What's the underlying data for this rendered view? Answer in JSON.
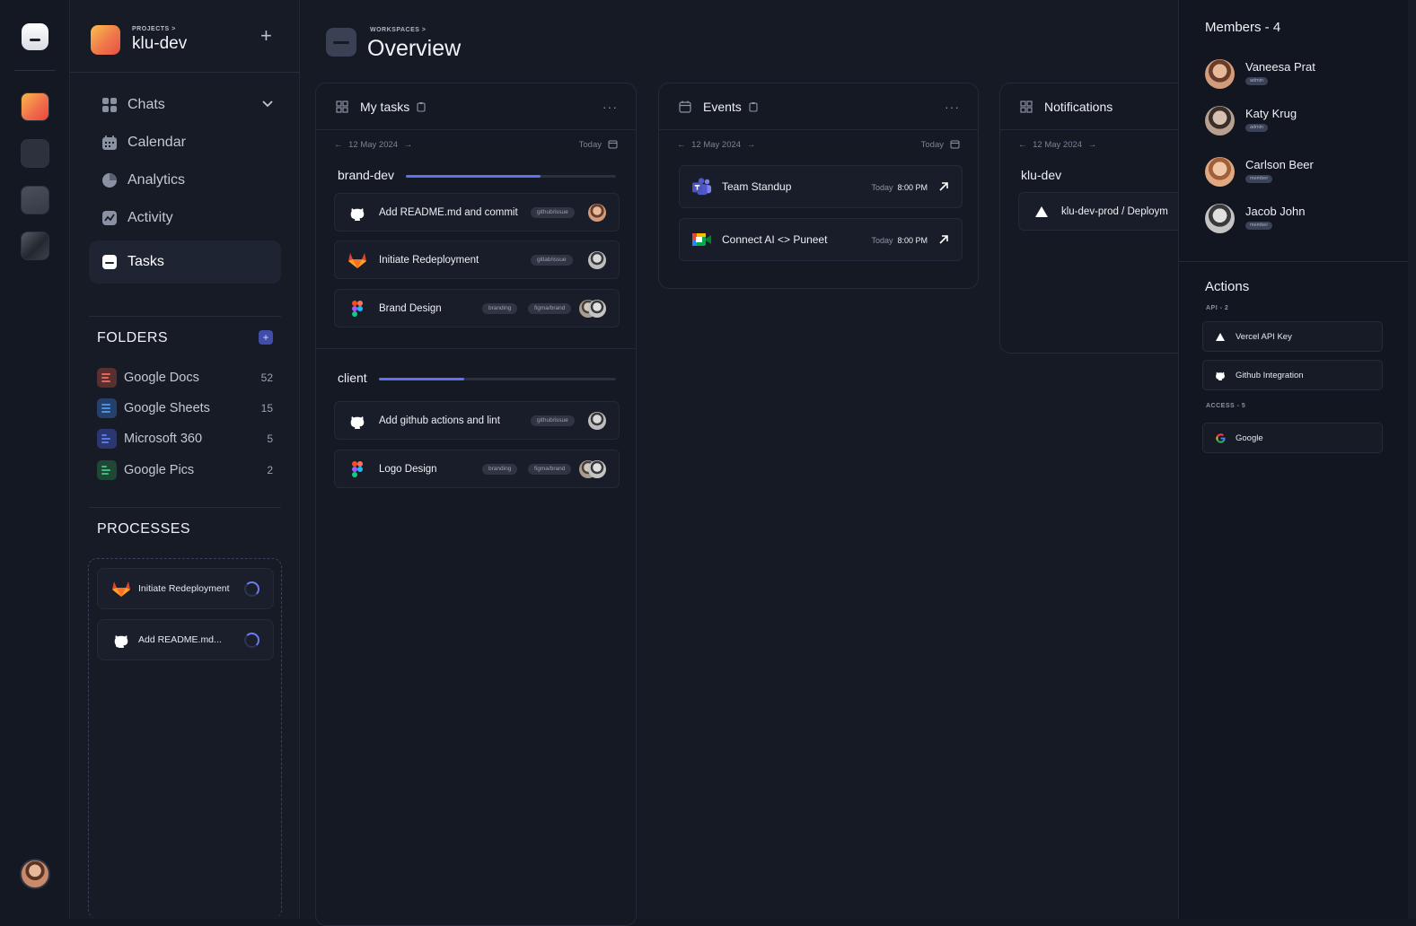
{
  "sidebar": {
    "crumb": "PROJECTS >",
    "project_name": "klu-dev",
    "nav": [
      {
        "label": "Chats"
      },
      {
        "label": "Calendar"
      },
      {
        "label": "Analytics"
      },
      {
        "label": "Activity"
      },
      {
        "label": "Tasks"
      }
    ],
    "folders_title": "FOLDERS",
    "folders": [
      {
        "label": "Google Docs",
        "count": "52",
        "color": "#e0675a"
      },
      {
        "label": "Google Sheets",
        "count": "15",
        "color": "#4a8fe0"
      },
      {
        "label": "Microsoft 360",
        "count": "5",
        "color": "#5a78e6"
      },
      {
        "label": "Google Pics",
        "count": "2",
        "color": "#3cbf7a"
      }
    ],
    "processes_title": "PROCESSES",
    "processes": [
      {
        "label": "Initiate Redeployment",
        "icon": "gitlab-icon"
      },
      {
        "label": "Add README.md...",
        "icon": "github-icon"
      }
    ]
  },
  "header": {
    "crumb": "WORKSPACES >",
    "title": "Overview"
  },
  "tasks_card": {
    "title": "My tasks",
    "date": "12 May 2024",
    "today": "Today",
    "groups": [
      {
        "name": "brand-dev",
        "progress": 0.64,
        "tasks": [
          {
            "label": "Add README.md and commit",
            "icon": "github-icon",
            "tags": [
              "github/issue"
            ]
          },
          {
            "label": "Initiate Redeployment",
            "icon": "gitlab-icon",
            "tags": [
              "gitlab/issue"
            ]
          },
          {
            "label": "Brand Design",
            "icon": "figma-icon",
            "tags": [
              "branding",
              "figma/brand"
            ]
          }
        ]
      },
      {
        "name": "client",
        "progress": 0.36,
        "tasks": [
          {
            "label": "Add github actions and lint",
            "icon": "github-icon",
            "tags": [
              "github/issue"
            ]
          },
          {
            "label": "Logo Design",
            "icon": "figma-icon",
            "tags": [
              "branding",
              "figma/brand"
            ]
          }
        ]
      }
    ]
  },
  "events_card": {
    "title": "Events",
    "date": "12 May 2024",
    "today": "Today",
    "events": [
      {
        "label": "Team Standup",
        "icon": "teams-icon",
        "day": "Today",
        "time": "8:00 PM"
      },
      {
        "label": "Connect AI <> Puneet",
        "icon": "google-meet-icon",
        "day": "Today",
        "time": "8:00 PM"
      }
    ]
  },
  "notifications_card": {
    "title": "Notifications",
    "date": "12 May 2024",
    "group": "klu-dev",
    "item": "klu-dev-prod / Deploym"
  },
  "members": {
    "title": "Members - 4",
    "list": [
      {
        "name": "Vaneesa Prat",
        "role": "admin"
      },
      {
        "name": "Katy Krug",
        "role": "admin"
      },
      {
        "name": "Carlson Beer",
        "role": "member"
      },
      {
        "name": "Jacob John",
        "role": "member"
      }
    ]
  },
  "actions": {
    "title": "Actions",
    "api_label": "API - 2",
    "api": [
      {
        "label": "Vercel API Key",
        "icon": "vercel-icon"
      },
      {
        "label": "Github Integration",
        "icon": "github-icon"
      }
    ],
    "access_label": "ACCESS - 5",
    "access": [
      {
        "label": "Google",
        "icon": "google-icon"
      }
    ]
  }
}
